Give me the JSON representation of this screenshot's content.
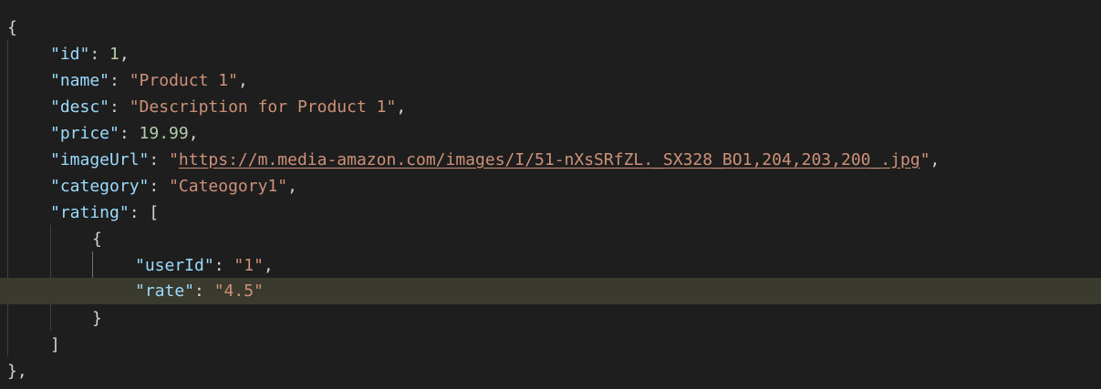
{
  "editor": {
    "colors": {
      "background": "#1e1e1e",
      "key": "#9cdcfe",
      "string": "#ce9178",
      "number": "#b5cea8",
      "punctuation": "#d4d4d4",
      "current_line": "#3a3a2e"
    },
    "json": {
      "open_brace": "{",
      "id_key": "\"id\"",
      "id_value": "1",
      "name_key": "\"name\"",
      "name_value": "\"Product 1\"",
      "desc_key": "\"desc\"",
      "desc_value": "\"Description for Product 1\"",
      "price_key": "\"price\"",
      "price_value": "19.99",
      "imageUrl_key": "\"imageUrl\"",
      "imageUrl_quote": "\"",
      "imageUrl_link": "https://m.media-amazon.com/images/I/51-nXsSRfZL._SX328_BO1,204,203,200_.jpg",
      "category_key": "\"category\"",
      "category_value": "\"Cateogory1\"",
      "rating_key": "\"rating\"",
      "rating_open": "[",
      "inner_open": "{",
      "userId_key": "\"userId\"",
      "userId_value": "\"1\"",
      "rate_key": "\"rate\"",
      "rate_value": "\"4.5\"",
      "inner_close": "}",
      "rating_close": "]",
      "close_brace": "},"
    },
    "punct": {
      "colon": ": ",
      "comma": ","
    }
  }
}
